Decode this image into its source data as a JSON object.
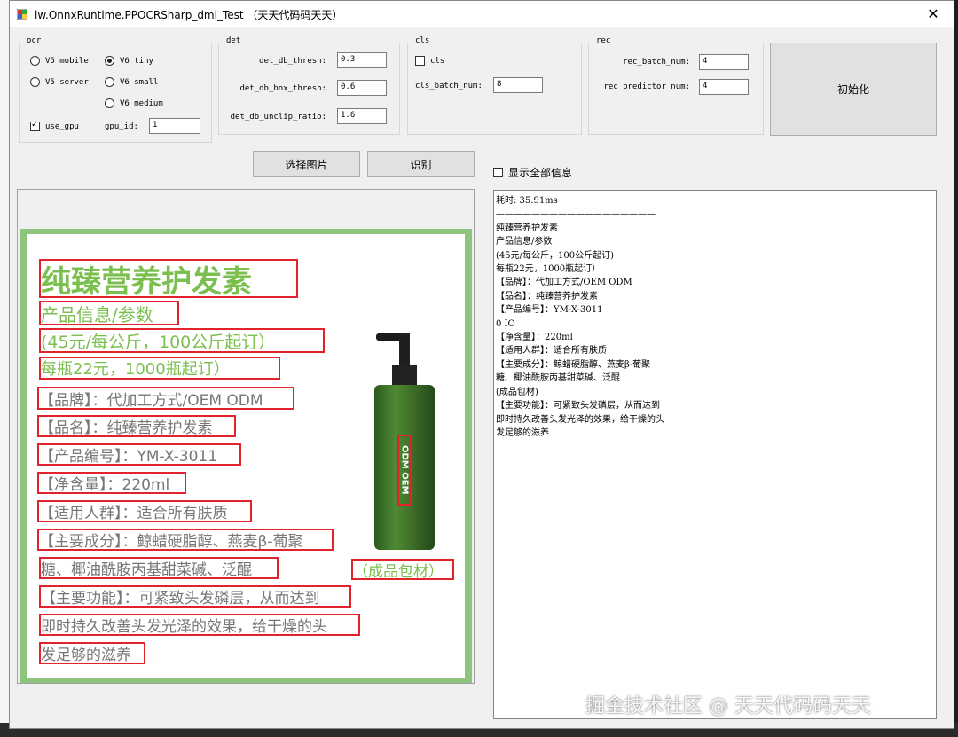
{
  "window": {
    "title": "lw.OnnxRuntime.PPOCRSharp_dml_Test （天天代码码天天）",
    "close_glyph": "✕"
  },
  "ocr_group": {
    "label": "ocr",
    "options": [
      "V5 mobile",
      "V6 tiny",
      "V5 server",
      "V6 small",
      "V6 medium"
    ],
    "selected": "V6 tiny",
    "use_gpu_label": "use_gpu",
    "use_gpu_checked": true,
    "gpu_id_label": "gpu_id:",
    "gpu_id_value": "1"
  },
  "det_group": {
    "label": "det",
    "thresh_label": "det_db_thresh:",
    "thresh_value": "0.3",
    "box_thresh_label": "det_db_box_thresh:",
    "box_thresh_value": "0.6",
    "unclip_label": "det_db_unclip_ratio:",
    "unclip_value": "1.6"
  },
  "cls_group": {
    "label": "cls",
    "cls_checkbox_label": "cls",
    "cls_checked": false,
    "batch_label": "cls_batch_num:",
    "batch_value": "8"
  },
  "rec_group": {
    "label": "rec",
    "batch_label": "rec_batch_num:",
    "batch_value": "4",
    "predictor_label": "rec_predictor_num:",
    "predictor_value": "4"
  },
  "buttons": {
    "init": "初始化",
    "select_image": "选择图片",
    "recognize": "识别"
  },
  "show_all": {
    "label": "显示全部信息",
    "checked": false
  },
  "result": {
    "text": "耗时: 35.91ms\n——————————————————\n纯臻营养护发素\n产品信息/参数\n(45元/每公斤，100公斤起订)\n每瓶22元，1000瓶起订）\n【品牌】：代加工方式/OEM ODM\n【品名】：纯臻营养护发素\n【产品编号】：YM-X-3011\n0 IO\n【净含量】：220ml\n【适用人群】：适合所有肤质\n【主要成分】：鲸蜡硬脂醇、燕麦β-葡聚\n糖、椰油酰胺丙基甜菜碱、泛醌\n(成品包材)\n【主要功能】：可紧致头发磷层，从而达到\n即时持久改善头发光泽的效果，给干燥的头\n发足够的滋养"
  },
  "image_texts": {
    "title": "纯臻营养护发素",
    "info": "产品信息/参数",
    "price1": "(45元/每公斤，100公斤起订）",
    "price2": "每瓶22元，1000瓶起订）",
    "brand": "【品牌】：代加工方式/OEM ODM",
    "name": "【品名】：纯臻营养护发素",
    "code": "【产品编号】：YM-X-3011",
    "volume": "【净含量】：220ml",
    "people": "【适用人群】：适合所有肤质",
    "ingredients1": "【主要成分】：鲸蜡硬脂醇、燕麦β-葡聚",
    "ingredients2": "糖、椰油酰胺丙基甜菜碱、泛醌",
    "package": "（成品包材）",
    "function1": "【主要功能】：可紧致头发磷层，从而达到",
    "function2": "即时持久改善头发光泽的效果，给干燥的头",
    "function3": "发足够的滋养",
    "bottle_label": "ODM OEM"
  },
  "watermark": {
    "text": "掘金技术社区 @ 天天代码码天天"
  }
}
